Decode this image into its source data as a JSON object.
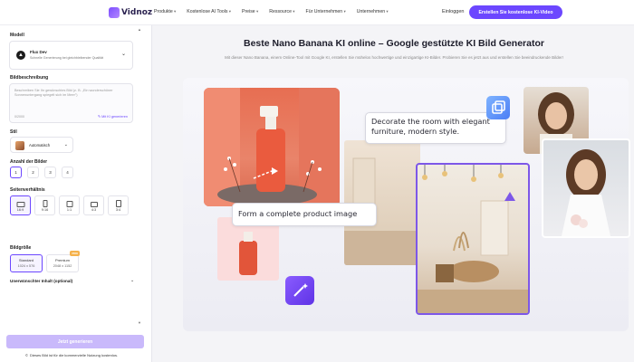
{
  "nav": {
    "logo": "Vidnoz",
    "menu": [
      "Produkte",
      "Kostenlose AI Tools",
      "Preise",
      "Ressource",
      "Für Unternehmen",
      "Unternehmen"
    ],
    "login": "Einloggen",
    "cta": "Erstellen Sie kostenlose KI-Video"
  },
  "sidebar": {
    "model_label": "Modell",
    "model_name": "Flux Dev",
    "model_desc": "Schnelle Generierung bei gleichbleibender Qualität",
    "desc_label": "Bildbeschreibung",
    "desc_placeholder": "Beschreiben Sie Ihr gewünschtes Bild (z. B. „Ein wunderschöner Sonnenuntergang spiegelt sich im Meer\")",
    "desc_count": "0/2000",
    "desc_generate": "Mit KI generieren",
    "style_label": "Stil",
    "style_value": "Automatisch",
    "count_label": "Anzahl der Bilder",
    "counts": [
      "1",
      "2",
      "3",
      "4"
    ],
    "ratio_label": "Seitenverhältnis",
    "ratios": [
      "16:9",
      "9:16",
      "1:1",
      "4:3",
      "3:4"
    ],
    "size_label": "Bildgröße",
    "sizes": [
      {
        "name": "Standard",
        "dim": "1024 x 576"
      },
      {
        "name": "Premium",
        "dim": "2048 x 1152",
        "badge": "PRO"
      }
    ],
    "negative_label": "Unerwünschter Inhalt (optional)",
    "generate_button": "Jetzt generieren",
    "notice": "Dieses Bild ist für die kommerzielle Nutzung kostenlos."
  },
  "main": {
    "headline": "Beste Nano Banana KI online – Google gestützte KI Bild Generator",
    "subline": "Mit dieser Nano Banana, einem Online-Tool mit Google KI, erstellen Sie mühelos hochwertige und einzigartige KI-Bilder. Probieren Sie es jetzt aus und erstellen Sie beeindruckende Bilder!",
    "bubble_room": "Decorate the room with elegant furniture, modern style.",
    "bubble_product": "Form a complete product image"
  },
  "colors": {
    "accent": "#6c47ff",
    "generate_disabled": "#c9b9fb"
  }
}
